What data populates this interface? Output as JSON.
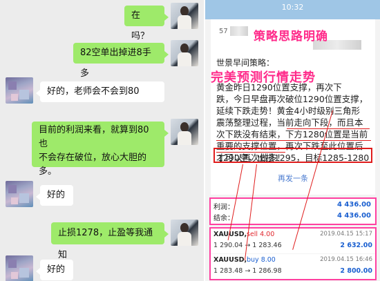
{
  "chat": {
    "messages": [
      {
        "side": "right",
        "text": "在吗？"
      },
      {
        "side": "right",
        "text": "82空单出掉进8手多"
      },
      {
        "side": "left",
        "text": "好的，老师会不会到80"
      },
      {
        "side": "right",
        "lines": [
          "目前的利润来看，就算到80也",
          "不会存在破位，放心大胆的",
          "多。"
        ]
      },
      {
        "side": "left",
        "text": "好的"
      },
      {
        "side": "right",
        "text": "止损1278，止盈等我通知"
      },
      {
        "side": "left",
        "text": "好的"
      }
    ]
  },
  "phone": {
    "status_time": "10:32",
    "blurred_prefix": "57",
    "headline_top": "策略思路明确",
    "headline_mid": "完美预测行情走势",
    "title": "世景早间策略：",
    "strategy_lines": [
      "黄金昨日1290位置支撑，再次下",
      "跌，今日早盘再次破位1290位置支撑，",
      "延续下跌走势！黄金4小时级别三角形",
      "震荡整理过程，当前走向下段，而且本",
      "次下跌没有结束，下方1280位置是当前",
      "重要的支撑位置，再次下跌至此位置后",
      "才可以再次做多！"
    ],
    "result": "1290空，止损1295，目标1285-1280",
    "more_link": "再发一条",
    "account": [
      {
        "label": "利润：",
        "value": "4 436.00"
      },
      {
        "label": "结余：",
        "value": "4 436.00"
      }
    ],
    "orders": [
      {
        "symbol": "XAUUSD,",
        "side": "sell 4.00",
        "prices": "1 290.04 → 1 283.46",
        "time": "2019.04.15 15:17",
        "pnl": "2 632.00"
      },
      {
        "symbol": "XAUUSD,",
        "side": "buy 8.00",
        "prices": "1 283.48 → 1 286.98",
        "time": "2019.04.15 16:46",
        "pnl": "2 800.00"
      }
    ]
  },
  "colors": {
    "chat_green": "#9eea6a",
    "chat_bg": "#ececec",
    "highlight_pink": "#ff3fa0",
    "annotation_red": "#e01c1c",
    "profit_blue": "#1a5fd0"
  }
}
